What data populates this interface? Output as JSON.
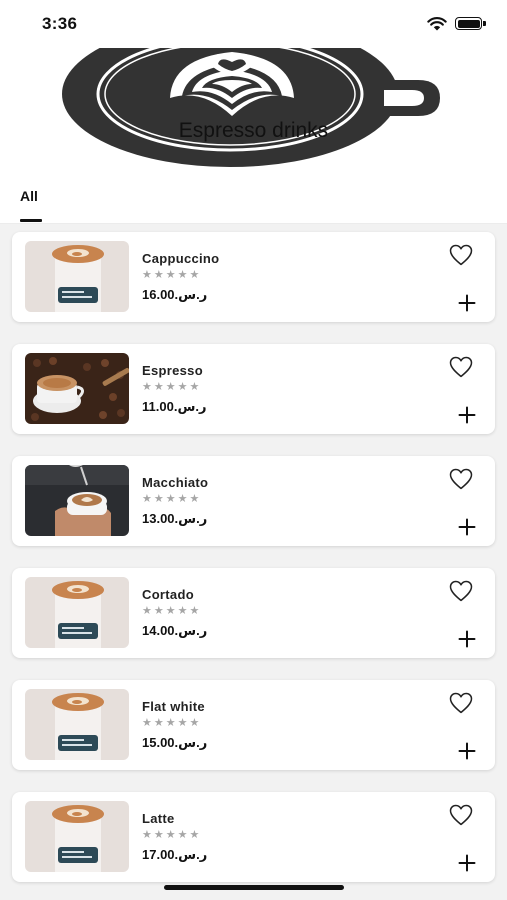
{
  "status_bar": {
    "time": "3:36"
  },
  "header": {
    "title": "Espresso drinks"
  },
  "tabs": {
    "active": "All"
  },
  "products": [
    {
      "name": "Cappuccino",
      "stars": "★★★★★",
      "price": "ر.س.16.00",
      "image": "cup"
    },
    {
      "name": "Espresso",
      "stars": "★★★★★",
      "price": "ر.س.11.00",
      "image": "espresso"
    },
    {
      "name": "Macchiato",
      "stars": "★★★★★",
      "price": "ر.س.13.00",
      "image": "macchiato"
    },
    {
      "name": "Cortado",
      "stars": "★★★★★",
      "price": "ر.س.14.00",
      "image": "cup"
    },
    {
      "name": "Flat white",
      "stars": "★★★★★",
      "price": "ر.س.15.00",
      "image": "cup"
    },
    {
      "name": "Latte",
      "stars": "★★★★★",
      "price": "ر.س.17.00",
      "image": "cup"
    }
  ],
  "icons": {
    "heart": "heart-outline-icon",
    "add": "plus-icon",
    "wifi": "wifi-icon",
    "battery": "battery-icon"
  }
}
